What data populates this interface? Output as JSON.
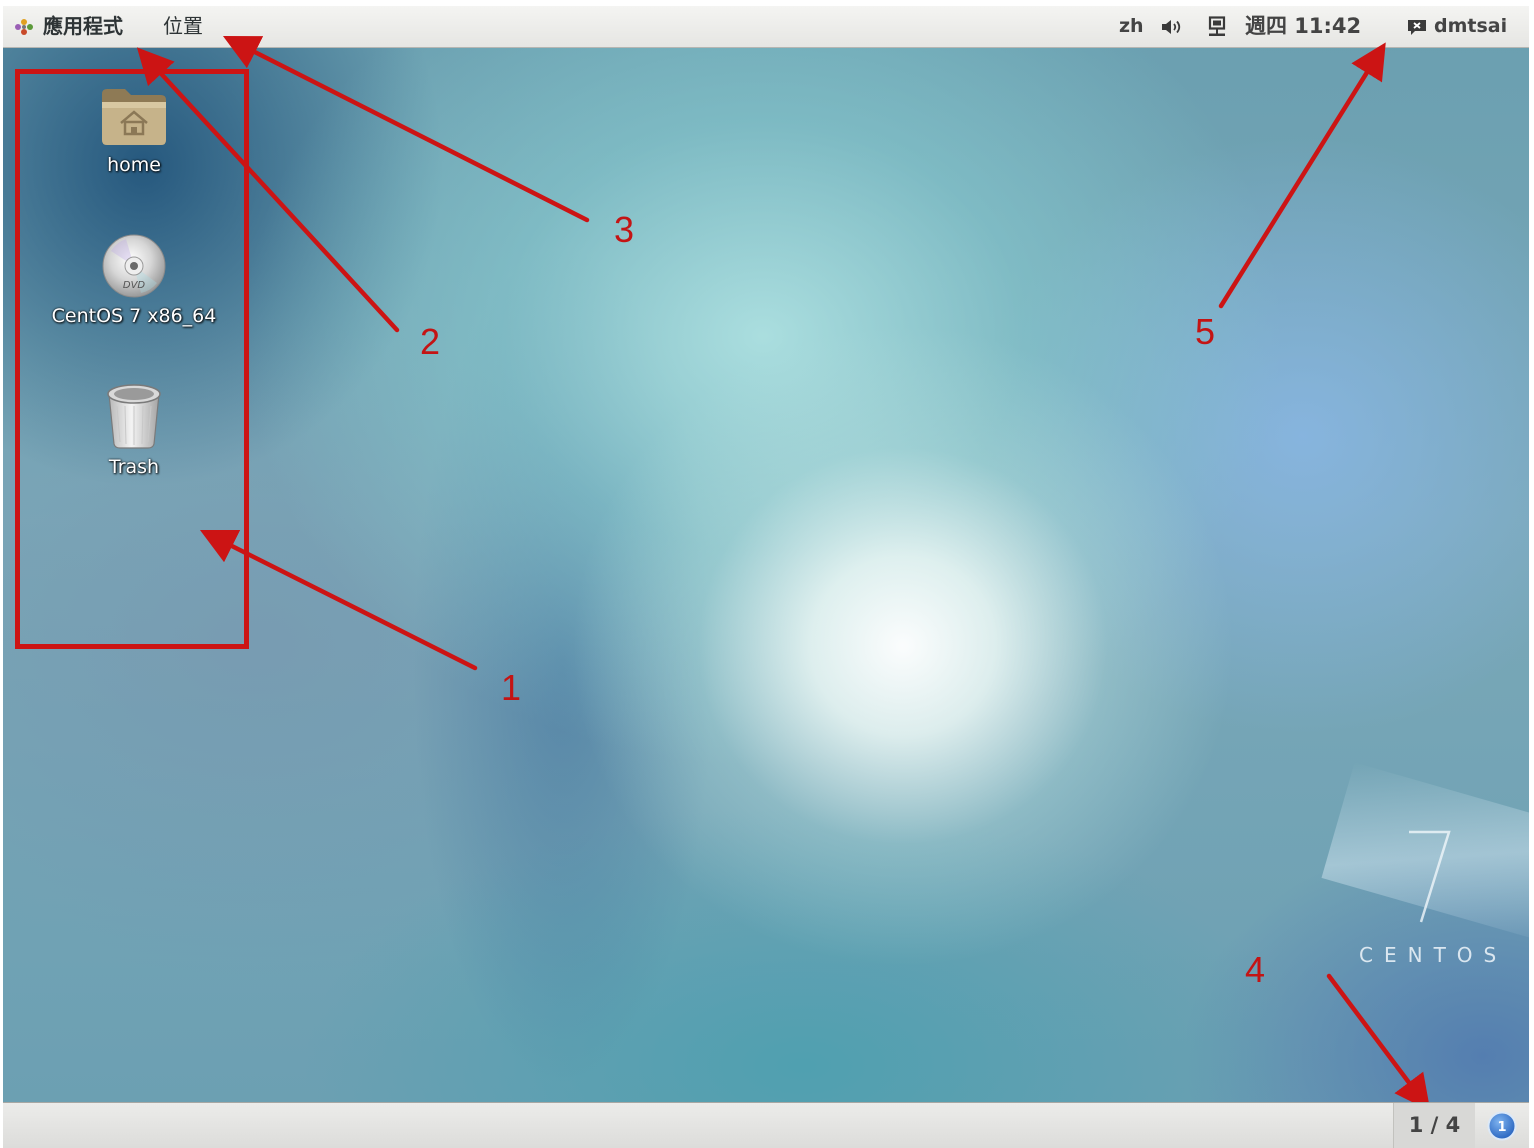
{
  "top_panel": {
    "applications_label": "應用程式",
    "places_label": "位置",
    "input_language": "zh",
    "clock": "週四 11:42",
    "user_name": "dmtsai"
  },
  "desktop": {
    "icons": [
      {
        "label": "home",
        "icon": "home-folder-icon"
      },
      {
        "label": "CentOS 7 x86_64",
        "icon": "dvd-icon"
      },
      {
        "label": "Trash",
        "icon": "trash-icon"
      }
    ]
  },
  "annotations": {
    "callouts": [
      "1",
      "2",
      "3",
      "4",
      "5"
    ],
    "color": "#cc1414"
  },
  "branding": {
    "version_numeral": "7",
    "distro_name": "CENTOS"
  },
  "bottom_panel": {
    "workspace_indicator": "1 / 4",
    "notification_count": "1"
  },
  "colors": {
    "panel": "#e9e9e7",
    "annotation_red": "#cc1414",
    "notification_blue": "#3a7fd5"
  }
}
